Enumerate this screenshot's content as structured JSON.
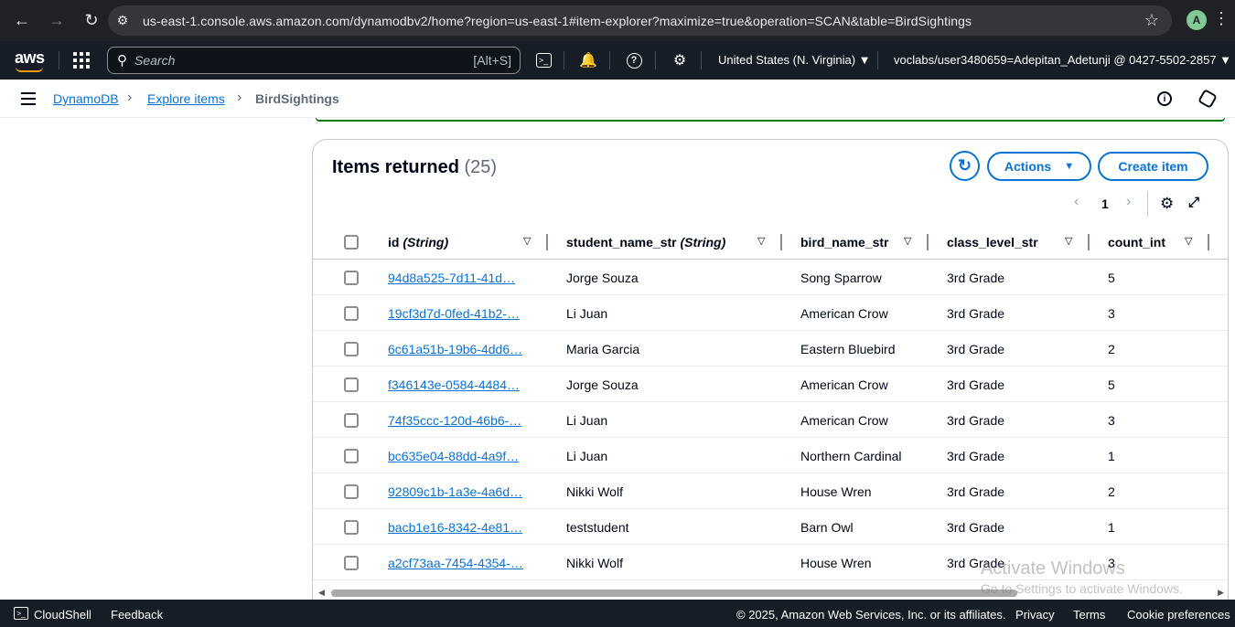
{
  "browser": {
    "url": "us-east-1.console.aws.amazon.com/dynamodbv2/home?region=us-east-1#item-explorer?maximize=true&operation=SCAN&table=BirdSightings",
    "profile_initial": "A"
  },
  "aws_nav": {
    "logo": "aws",
    "search_placeholder": "Search",
    "search_shortcut": "[Alt+S]",
    "region": "United States (N. Virginia) ▼",
    "account": "voclabs/user3480659=Adepitan_Adetunji @ 0427-5502-2857 ▼"
  },
  "breadcrumb": {
    "items": [
      "DynamoDB",
      "Explore items",
      "BirdSightings"
    ]
  },
  "panel": {
    "title": "Items returned",
    "count": "(25)",
    "actions_label": "Actions",
    "create_label": "Create item",
    "page_number": "1"
  },
  "table": {
    "columns": [
      {
        "name": "id",
        "type": "(String)"
      },
      {
        "name": "student_name_str",
        "type": "(String)"
      },
      {
        "name": "bird_name_str",
        "type": ""
      },
      {
        "name": "class_level_str",
        "type": ""
      },
      {
        "name": "count_int",
        "type": ""
      }
    ],
    "rows": [
      [
        "94d8a525-7d11-41d…",
        "Jorge Souza",
        "Song Sparrow",
        "3rd Grade",
        "5"
      ],
      [
        "19cf3d7d-0fed-41b2-…",
        "Li Juan",
        "American Crow",
        "3rd Grade",
        "3"
      ],
      [
        "6c61a51b-19b6-4dd6…",
        "Maria Garcia",
        "Eastern Bluebird",
        "3rd Grade",
        "2"
      ],
      [
        "f346143e-0584-4484…",
        "Jorge Souza",
        "American Crow",
        "3rd Grade",
        "5"
      ],
      [
        "74f35ccc-120d-46b6-…",
        "Li Juan",
        "American Crow",
        "3rd Grade",
        "3"
      ],
      [
        "bc635e04-88dd-4a9f…",
        "Li Juan",
        "Northern Cardinal",
        "3rd Grade",
        "1"
      ],
      [
        "92809c1b-1a3e-4a6d…",
        "Nikki Wolf",
        "House Wren",
        "3rd Grade",
        "2"
      ],
      [
        "bacb1e16-8342-4e81…",
        "teststudent",
        "Barn Owl",
        "3rd Grade",
        "1"
      ],
      [
        "a2cf73aa-7454-4354-…",
        "Nikki Wolf",
        "House Wren",
        "3rd Grade",
        "3"
      ]
    ]
  },
  "watermark": {
    "line1": "Activate Windows",
    "line2": "Go to Settings to activate Windows."
  },
  "footer": {
    "cloudshell": "CloudShell",
    "feedback": "Feedback",
    "copyright": "© 2025, Amazon Web Services, Inc. or its affiliates.",
    "privacy": "Privacy",
    "terms": "Terms",
    "cookies": "Cookie preferences"
  }
}
